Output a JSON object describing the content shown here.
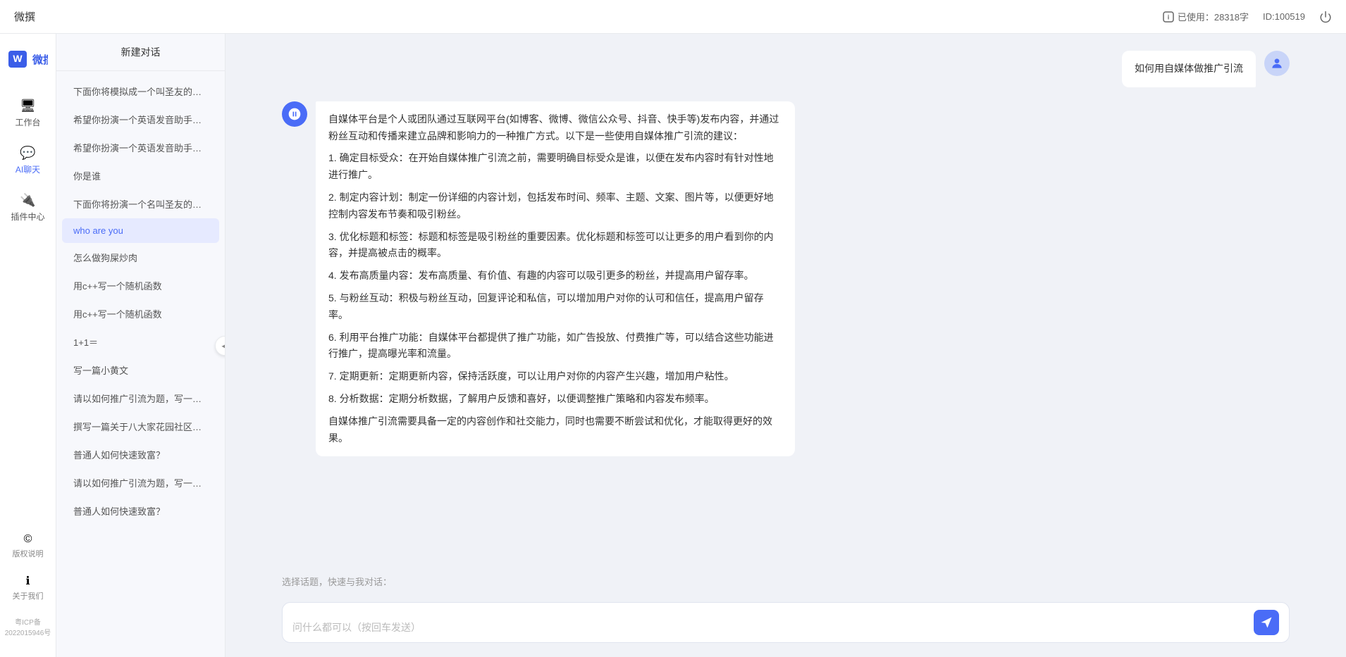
{
  "topbar": {
    "title": "微撰",
    "usage_label": "已使用：28318字",
    "id_label": "ID:100519",
    "usage_icon": "info-icon",
    "power_icon": "power-icon"
  },
  "logo": {
    "text": "微撰",
    "icon": "W"
  },
  "nav": {
    "items": [
      {
        "id": "workbench",
        "label": "工作台",
        "icon": "🖥",
        "active": false
      },
      {
        "id": "ai-chat",
        "label": "AI聊天",
        "icon": "💬",
        "active": true
      },
      {
        "id": "plugin",
        "label": "插件中心",
        "icon": "🔌",
        "active": false
      }
    ],
    "bottom": [
      {
        "id": "copyright",
        "label": "版权说明",
        "icon": "©"
      },
      {
        "id": "about",
        "label": "关于我们",
        "icon": "ℹ"
      }
    ],
    "icp": "粤ICP备2022015946号"
  },
  "sidebar": {
    "new_chat": "新建对话",
    "items": [
      {
        "id": 1,
        "text": "下面你将模拟成一个叫圣友的程序员，我说...",
        "active": false
      },
      {
        "id": 2,
        "text": "希望你扮演一个英语发音助手，我提供给你...",
        "active": false
      },
      {
        "id": 3,
        "text": "希望你扮演一个英语发音助手，我提供给你...",
        "active": false
      },
      {
        "id": 4,
        "text": "你是谁",
        "active": false
      },
      {
        "id": 5,
        "text": "下面你将扮演一个名叫圣友的医生",
        "active": false
      },
      {
        "id": 6,
        "text": "who are you",
        "active": true
      },
      {
        "id": 7,
        "text": "怎么做狗屎炒肉",
        "active": false
      },
      {
        "id": 8,
        "text": "用c++写一个随机函数",
        "active": false
      },
      {
        "id": 9,
        "text": "用c++写一个随机函数",
        "active": false
      },
      {
        "id": 10,
        "text": "1+1＝",
        "active": false
      },
      {
        "id": 11,
        "text": "写一篇小黄文",
        "active": false
      },
      {
        "id": 12,
        "text": "请以如何推广引流为题，写一篇大纲",
        "active": false
      },
      {
        "id": 13,
        "text": "撰写一篇关于八大家花园社区一刻钟便民生...",
        "active": false
      },
      {
        "id": 14,
        "text": "普通人如何快速致富？",
        "active": false
      },
      {
        "id": 15,
        "text": "请以如何推广引流为题，写一篇大纲",
        "active": false
      },
      {
        "id": 16,
        "text": "普通人如何快速致富？",
        "active": false
      }
    ]
  },
  "chat": {
    "messages": [
      {
        "id": 1,
        "role": "user",
        "text": "如何用自媒体做推广引流",
        "avatar_type": "user"
      },
      {
        "id": 2,
        "role": "ai",
        "paragraphs": [
          "自媒体平台是个人或团队通过互联网平台(如博客、微博、微信公众号、抖音、快手等)发布内容，并通过粉丝互动和传播来建立品牌和影响力的一种推广方式。以下是一些使用自媒体推广引流的建议：",
          "1. 确定目标受众：在开始自媒体推广引流之前，需要明确目标受众是谁，以便在发布内容时有针对性地进行推广。",
          "2. 制定内容计划：制定一份详细的内容计划，包括发布时间、频率、主题、文案、图片等，以便更好地控制内容发布节奏和吸引粉丝。",
          "3. 优化标题和标签：标题和标签是吸引粉丝的重要因素。优化标题和标签可以让更多的用户看到你的内容，并提高被点击的概率。",
          "4. 发布高质量内容：发布高质量、有价值、有趣的内容可以吸引更多的粉丝，并提高用户留存率。",
          "5. 与粉丝互动：积极与粉丝互动，回复评论和私信，可以增加用户对你的认可和信任，提高用户留存率。",
          "6. 利用平台推广功能：自媒体平台都提供了推广功能，如广告投放、付费推广等，可以结合这些功能进行推广，提高曝光率和流量。",
          "7. 定期更新：定期更新内容，保持活跃度，可以让用户对你的内容产生兴趣，增加用户粘性。",
          "8. 分析数据：定期分析数据，了解用户反馈和喜好，以便调整推广策略和内容发布频率。",
          "自媒体推广引流需要具备一定的内容创作和社交能力，同时也需要不断尝试和优化，才能取得更好的效果。"
        ],
        "avatar_type": "ai"
      }
    ],
    "quick_label": "选择话题，快速与我对话：",
    "input_placeholder": "问什么都可以（按回车发送）",
    "send_icon": "send-icon"
  }
}
